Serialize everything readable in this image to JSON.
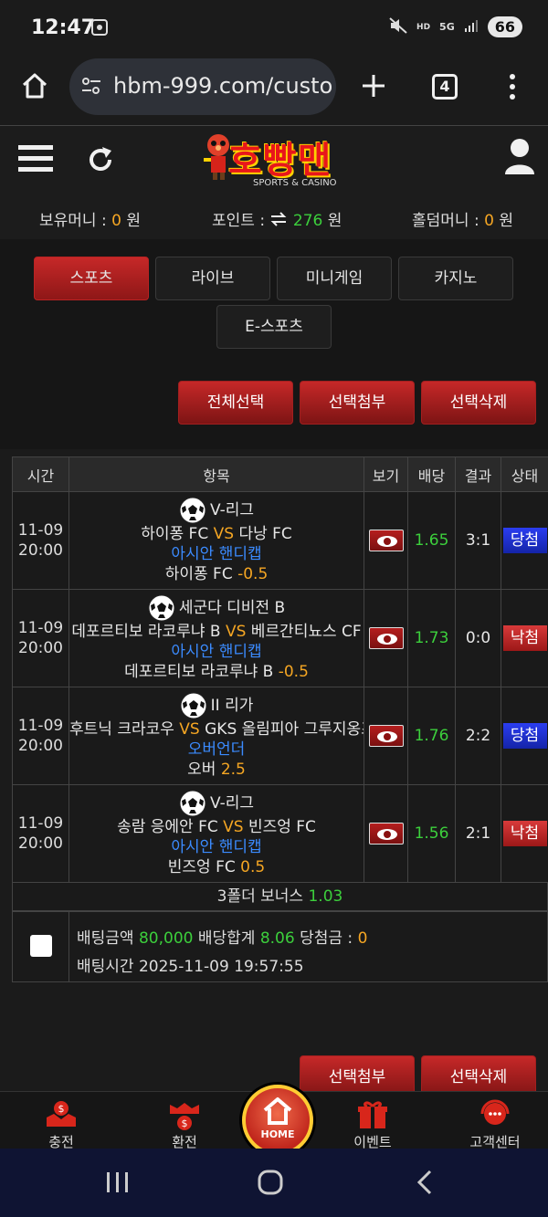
{
  "status_bar": {
    "time": "12:47",
    "network": "5G",
    "battery": "66"
  },
  "browser": {
    "url": "hbm-999.com/custo",
    "tab_count": "4"
  },
  "site": {
    "logo_text": "호빵맨",
    "logo_subtitle": "SPORTS & CASINO",
    "balances": {
      "money_label": "보유머니 :",
      "money_value": "0",
      "money_unit": "원",
      "point_label": "포인트 :",
      "point_value": "276",
      "point_unit": "원",
      "holdem_label": "홀덤머니 :",
      "holdem_value": "0",
      "holdem_unit": "원"
    }
  },
  "tabs": [
    "스포츠",
    "라이브",
    "미니게임",
    "카지노",
    "E-스포츠"
  ],
  "actions": {
    "select_all": "전체선택",
    "attach_selected": "선택첨부",
    "delete_selected": "선택삭제"
  },
  "table": {
    "headers": [
      "시간",
      "항목",
      "보기",
      "배당",
      "결과",
      "상태"
    ],
    "rows": [
      {
        "date": "11-09",
        "time": "20:00",
        "league": "V-리그",
        "home": "하이퐁 FC",
        "vs": "VS",
        "away": "다낭 FC",
        "market": "아시안 핸디캡",
        "pick": "하이퐁 FC",
        "pick_value": "-0.5",
        "odds": "1.65",
        "result": "3:1",
        "status": "당첨"
      },
      {
        "date": "11-09",
        "time": "20:00",
        "league": "세군다 디비전 B",
        "home": "데포르티보 라코루냐 B",
        "vs": "VS",
        "away": "베르간티뇨스 CF",
        "market": "아시안 핸디캡",
        "pick": "데포르티보 라코루냐 B",
        "pick_value": "-0.5",
        "odds": "1.73",
        "result": "0:0",
        "status": "낙첨"
      },
      {
        "date": "11-09",
        "time": "20:00",
        "league": "II 리가",
        "home": "후트닉 크라코우",
        "vs": "VS",
        "away": "GKS 올림피아 그루지옹즈",
        "market": "오버언더",
        "pick": "오버",
        "pick_value": "2.5",
        "odds": "1.76",
        "result": "2:2",
        "status": "당첨"
      },
      {
        "date": "11-09",
        "time": "20:00",
        "league": "V-리그",
        "home": "송람 응에안 FC",
        "vs": "VS",
        "away": "빈즈엉 FC",
        "market": "아시안 핸디캡",
        "pick": "빈즈엉 FC",
        "pick_value": "0.5",
        "odds": "1.56",
        "result": "2:1",
        "status": "낙첨"
      }
    ]
  },
  "bonus": {
    "label": "3폴더 보너스",
    "value": "1.03"
  },
  "summary": {
    "bet_amount_label": "배팅금액",
    "bet_amount": "80,000",
    "total_odds_label": "배당합계",
    "total_odds": "8.06",
    "win_amount_label": "당첨금 :",
    "win_amount": "0",
    "bet_time_label": "배팅시간",
    "bet_time": "2025-11-09 19:57:55"
  },
  "bottom_nav": {
    "deposit": "충전",
    "withdraw": "환전",
    "home": "HOME",
    "event": "이벤트",
    "support": "고객센터"
  },
  "colors": {
    "accent_red": "#c62828",
    "win_blue": "#2b3df0",
    "odds_green": "#3ccf3c",
    "highlight_orange": "#f5a623",
    "market_blue": "#3b8bff"
  }
}
